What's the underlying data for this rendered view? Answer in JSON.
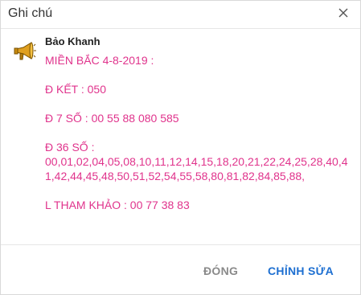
{
  "dialog": {
    "title": "Ghi chú"
  },
  "note": {
    "sender": "Bảo Khanh",
    "lines": [
      "MIỀN BẮC 4-8-2019 :",
      "",
      "Đ  KẾT : 050",
      "",
      "Đ 7 SỐ : 00 55 88 080 585",
      "",
      "Đ  36 SỐ :",
      "00,01,02,04,05,08,10,11,12,14,15,18,20,21,22,24,25,28,40,41,42,44,45,48,50,51,52,54,55,58,80,81,82,84,85,88,",
      "",
      "L  THAM KHẢO : 00 77 38 83"
    ]
  },
  "footer": {
    "close_label": "ĐÓNG",
    "edit_label": "CHỈNH SỬA"
  },
  "colors": {
    "note_text": "#e0338c",
    "primary_button": "#1d6fd1",
    "secondary_button": "#8a8a8a"
  },
  "icons": {
    "avatar": "megaphone-icon",
    "close": "close-icon"
  }
}
